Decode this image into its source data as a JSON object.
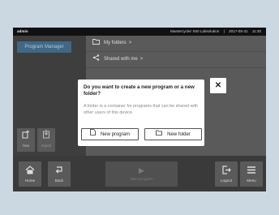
{
  "statusbar": {
    "user": "admin",
    "device": "Mastercycler X50 Labsolution",
    "separator": "|",
    "date": "2017-05-31",
    "time": "11:30"
  },
  "sidebar": {
    "program_manager": "Program Manager",
    "new_label": "New",
    "import_label": "Import"
  },
  "content": {
    "rows": [
      {
        "label": "My folders",
        "chevron": ">"
      },
      {
        "label": "Shared with me",
        "chevron": ">"
      }
    ]
  },
  "bottombar": {
    "home_label": "Home",
    "back_label": "Back",
    "start_label": "Start program",
    "logout_label": "Logout",
    "menu_label": "Menu"
  },
  "dialog": {
    "title": "Do you want to create a new program or a new folder?",
    "description": "A folder is a container for programs that can be shared with other users of this device.",
    "new_program_label": "New program",
    "new_folder_label": "New folder",
    "close_glyph": "✕"
  },
  "icons": {
    "new": "new-document-icon",
    "import": "import-icon",
    "folder": "folder-icon",
    "share": "share-icon",
    "home": "home-icon",
    "back": "back-arrow-icon",
    "play": "play-icon",
    "logout": "logout-icon",
    "menu": "hamburger-menu-icon",
    "close": "close-icon"
  },
  "colors": {
    "background": "#cbd8e1",
    "accent": "#3f6887",
    "dialog": "#ffffff"
  }
}
